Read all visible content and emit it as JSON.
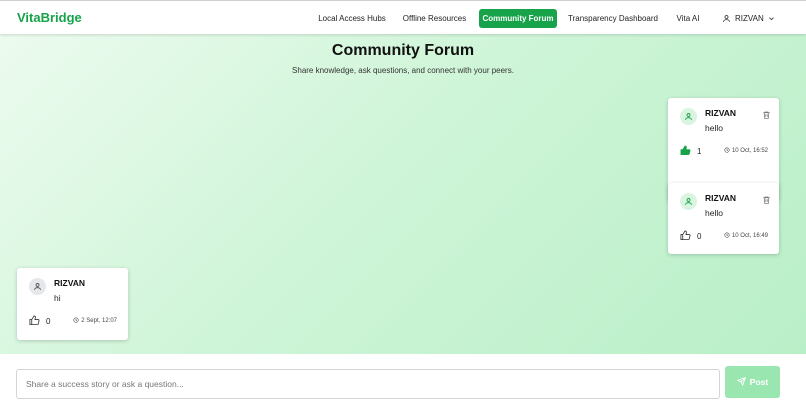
{
  "header": {
    "brand": "VitaBridge",
    "nav": [
      {
        "label": "Local Access Hubs"
      },
      {
        "label": "Offline Resources"
      },
      {
        "label": "Community Forum",
        "active": true
      },
      {
        "label": "Transparency Dashboard"
      },
      {
        "label": "Vita AI"
      }
    ],
    "user": "RIZVAN"
  },
  "page": {
    "title": "Community Forum",
    "subtitle": "Share knowledge, ask questions, and connect with your peers."
  },
  "posts": [
    {
      "author": "RIZVAN",
      "text": "hello",
      "likes": "1",
      "time": "10 Oct, 16:52",
      "liked": true,
      "own": true
    },
    {
      "author": "RIZVAN",
      "text": "hello",
      "likes": "0",
      "time": "10 Oct, 16:49",
      "liked": false,
      "own": true
    },
    {
      "author": "RIZVAN",
      "text": "hi",
      "likes": "0",
      "time": "2 Sept, 12:07",
      "liked": false,
      "own": false
    }
  ],
  "composer": {
    "placeholder": "Share a success story or ask a question...",
    "button_label": "Post"
  },
  "colors": {
    "brand": "#16a34a",
    "post_button": "#9ae6b1",
    "avatar_own": "#d9f5e0",
    "avatar_other": "#e5e7eb"
  },
  "icons": {
    "avatar": "user-icon",
    "delete": "trash-icon",
    "like": "thumbs-up-icon",
    "time": "clock-icon",
    "post": "send-icon",
    "dropdown": "chevron-down-icon"
  }
}
